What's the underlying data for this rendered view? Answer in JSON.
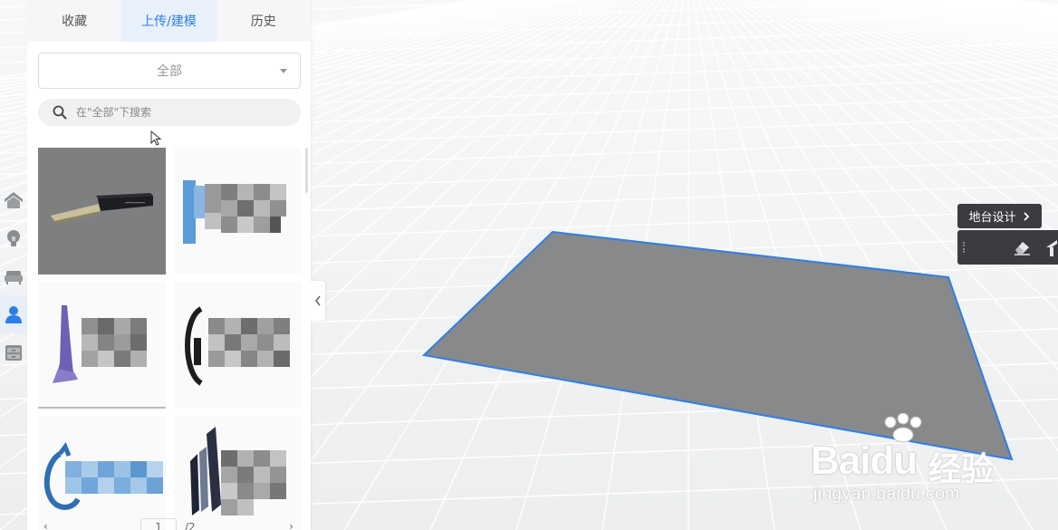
{
  "panel": {
    "tabs": [
      {
        "label": "收藏",
        "active": false
      },
      {
        "label": "上传/建模",
        "active": true
      },
      {
        "label": "历史",
        "active": false
      }
    ],
    "filter": {
      "value": "全部"
    },
    "search": {
      "placeholder": "在\"全部\"下搜索"
    },
    "pagination": {
      "prev": "‹",
      "page": "1",
      "total": "/2",
      "next": "›"
    }
  },
  "rail": {
    "items": [
      {
        "icon": "roof-icon",
        "active": false
      },
      {
        "icon": "lightbulb-icon",
        "active": false
      },
      {
        "icon": "sofa-icon",
        "active": false
      },
      {
        "icon": "user-icon",
        "active": true
      },
      {
        "icon": "cabinet-icon",
        "active": false
      }
    ]
  },
  "toolbar": {
    "platform_label": "地台设计",
    "tools": [
      "eraser-icon",
      "angle-icon"
    ]
  },
  "watermark": {
    "logo": "Baidu",
    "brand": "经验",
    "url": "jingyan.baidu.com"
  },
  "colors": {
    "accent": "#2f7ee8",
    "platform_fill": "#87898b",
    "platform_edge": "#2f7ee8",
    "toolbar_bg": "#3a3c3f"
  }
}
